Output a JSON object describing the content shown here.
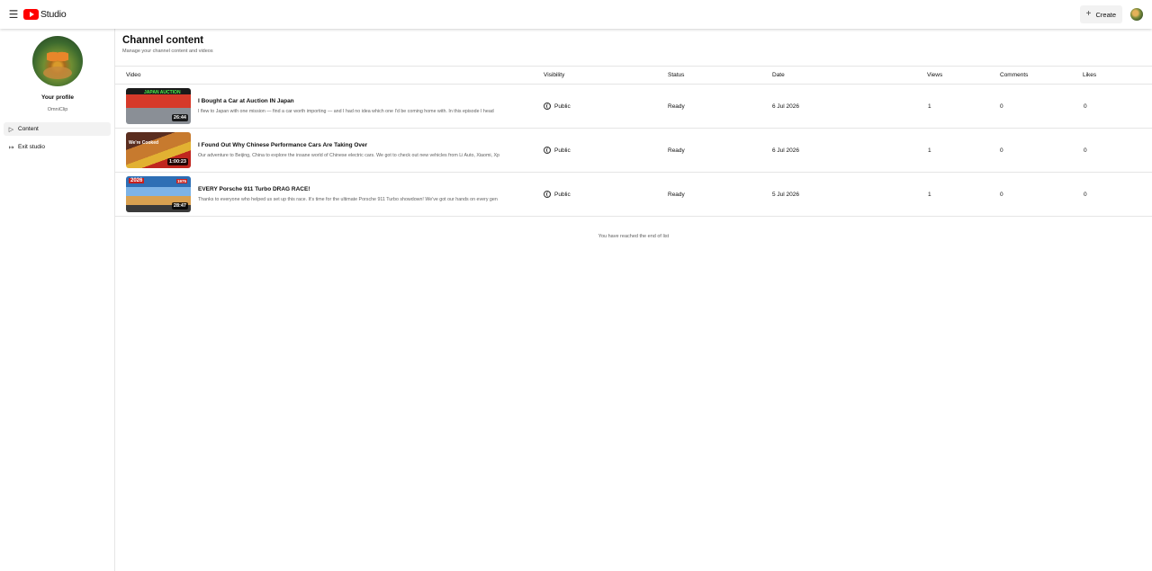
{
  "header": {
    "app_name": "Studio",
    "create_label": "Create",
    "menu_icon": "hamburger-icon"
  },
  "sidebar": {
    "profile_title": "Your profile",
    "profile_name": "OmniClip",
    "items": [
      {
        "label": "Content",
        "icon": "video-icon",
        "active": true
      },
      {
        "label": "Exit studio",
        "icon": "exit-icon",
        "active": false
      }
    ]
  },
  "main": {
    "title": "Channel content",
    "subtitle": "Manage your channel content and videos",
    "columns": {
      "video": "Video",
      "visibility": "Visibility",
      "status": "Status",
      "date": "Date",
      "views": "Views",
      "comments": "Comments",
      "likes": "Likes"
    },
    "videos": [
      {
        "title": "I Bought a Car at Auction IN Japan",
        "description": "I flew to Japan with one mission — find a car worth importing — and I had no idea which one I'd be coming home with. In this episode I head",
        "duration": "26:44",
        "thumb_text": "JAPAN AUCTION",
        "visibility": "Public",
        "status": "Ready",
        "date": "6 Jul 2026",
        "views": "1",
        "comments": "0",
        "likes": "0"
      },
      {
        "title": "I Found Out Why Chinese Performance Cars Are Taking Over",
        "description": "Our adventure to Beijing, China to explore the insane world of Chinese electric cars. We got to check out new vehicles from Li Auto, Xiaomi, Xp",
        "duration": "1:00:23",
        "thumb_text": "We're Cooked",
        "visibility": "Public",
        "status": "Ready",
        "date": "6 Jul 2026",
        "views": "1",
        "comments": "0",
        "likes": "0"
      },
      {
        "title": "EVERY Porsche 911 Turbo DRAG RACE!",
        "description": "Thanks to everyone who helped us set up this race. It's time for the ultimate Porsche 911 Turbo showdown! We've got our hands on every gen",
        "duration": "28:47",
        "thumb_text": "2026",
        "thumb_text2": "1975",
        "visibility": "Public",
        "status": "Ready",
        "date": "5 Jul 2026",
        "views": "1",
        "comments": "0",
        "likes": "0"
      }
    ],
    "end_note": "You have reached the end of list"
  }
}
